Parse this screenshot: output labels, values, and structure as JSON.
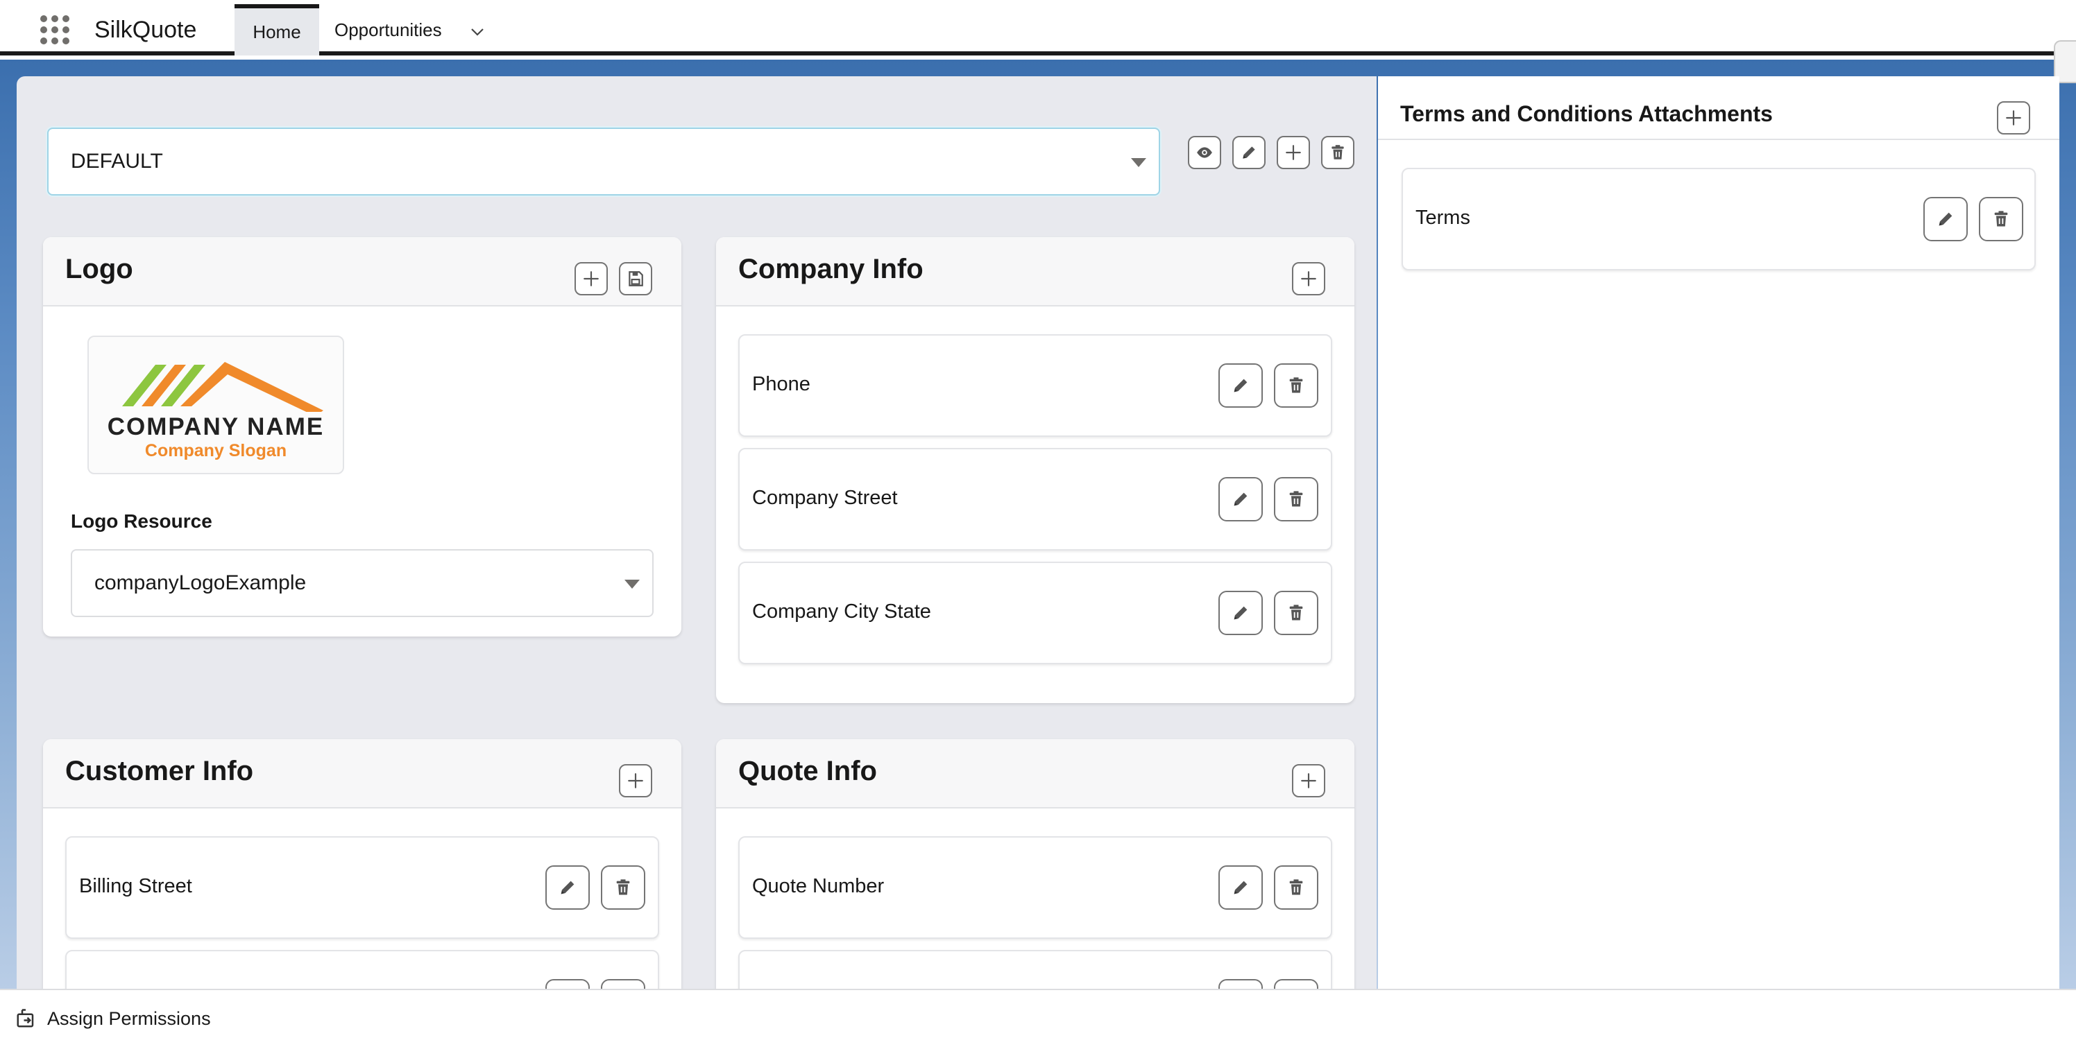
{
  "app": {
    "name": "SilkQuote"
  },
  "nav": {
    "tabs": [
      {
        "label": "Home"
      },
      {
        "label": "Opportunities"
      }
    ]
  },
  "template": {
    "selected": "DEFAULT"
  },
  "logo_card": {
    "title": "Logo",
    "logo_company_name": "COMPANY NAME",
    "logo_slogan": "Company Slogan",
    "resource_label": "Logo Resource",
    "resource_value": "companyLogoExample"
  },
  "company_info": {
    "title": "Company Info",
    "fields": [
      "Phone",
      "Company Street",
      "Company City State"
    ]
  },
  "customer_info": {
    "title": "Customer Info",
    "fields": [
      "Billing Street"
    ]
  },
  "quote_info": {
    "title": "Quote Info",
    "fields": [
      "Quote Number"
    ]
  },
  "terms": {
    "title": "Terms and Conditions Attachments",
    "items": [
      "Terms"
    ]
  },
  "utility_bar": {
    "label": "Assign Permissions"
  },
  "colors": {
    "accent_blue": "#3b6fae",
    "logo_orange": "#f08a2b",
    "logo_green": "#8dc63f"
  }
}
